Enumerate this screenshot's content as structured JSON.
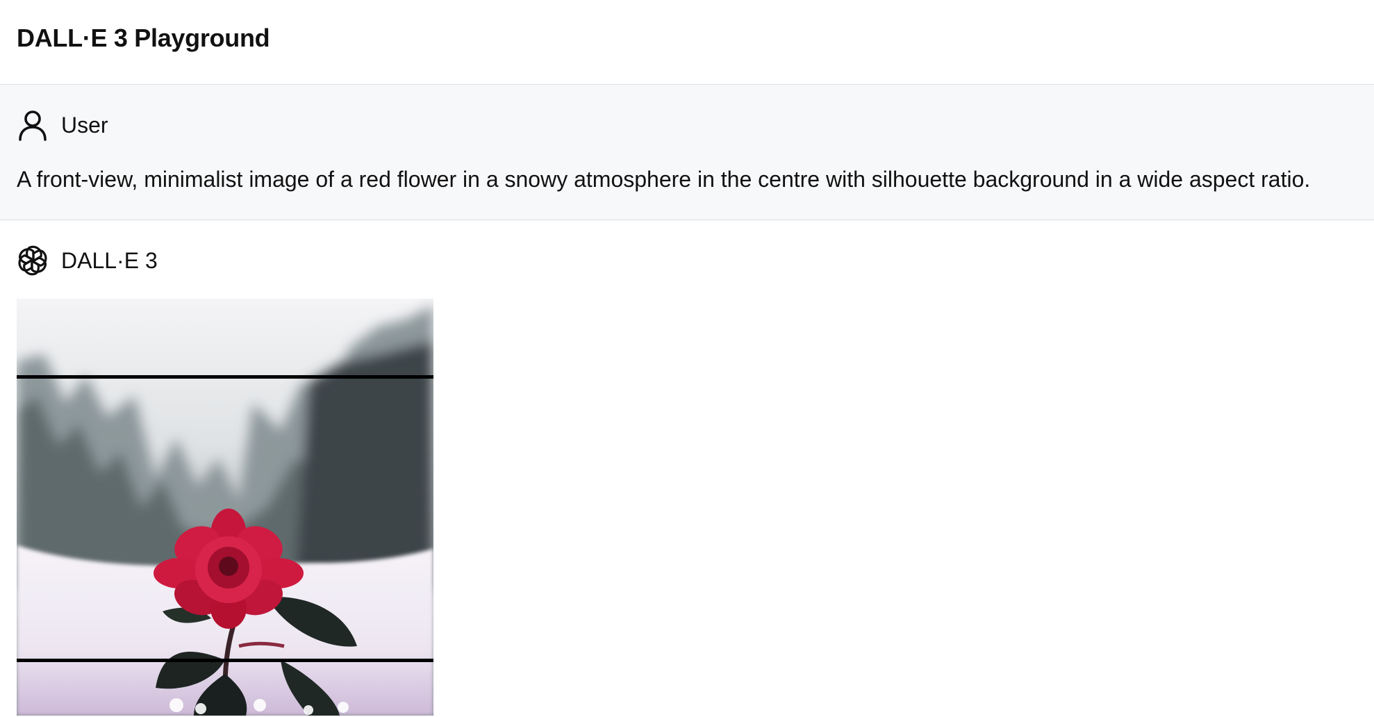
{
  "app": {
    "title": "DALL·E 3 Playground"
  },
  "messages": [
    {
      "role": "User",
      "icon": "user-icon",
      "text": "A front-view, minimalist image of a red flower in a snowy atmosphere in the centre with silhouette background in a wide aspect ratio."
    },
    {
      "role": "DALL·E 3",
      "icon": "openai-logo-icon",
      "image": "generated-image"
    }
  ],
  "colors": {
    "header_border": "#dcdfe4",
    "user_bg": "#f7f8fa",
    "flower_red": "#d0183f",
    "leaf_dark": "#1f2623",
    "snow": "#f1edf5"
  }
}
